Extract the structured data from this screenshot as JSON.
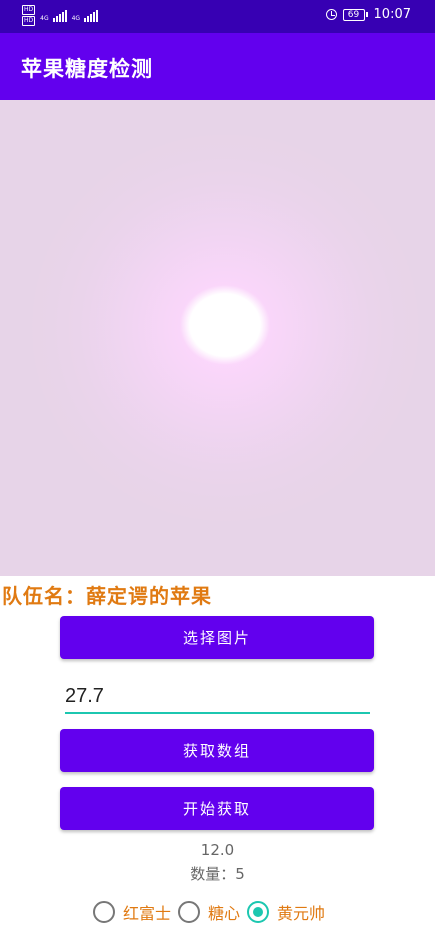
{
  "status_bar": {
    "hd1": "HD",
    "hd2": "HD",
    "network1": "4G",
    "network2": "4G",
    "battery": "69",
    "time": "10:07"
  },
  "app_bar": {
    "title": "苹果糖度检测"
  },
  "photo": {
    "icon": "image"
  },
  "team_label": "队伍名：薛定谔的苹果",
  "buttons": {
    "select_image": "选择图片",
    "get_array": "获取数组",
    "start": "开始获取"
  },
  "input": {
    "value": "27.7"
  },
  "result": {
    "value": "12.0",
    "count": "数量：5"
  },
  "radios": [
    {
      "label": "红富士",
      "checked": false
    },
    {
      "label": "糖心",
      "checked": false
    },
    {
      "label": "黄元帅",
      "checked": true
    }
  ],
  "colors": {
    "status_bar": "#3700b3",
    "app_bar": "#6200ee",
    "button": "#6200ee",
    "accent": "#1cc7b0",
    "team_text": "#e07a12"
  }
}
